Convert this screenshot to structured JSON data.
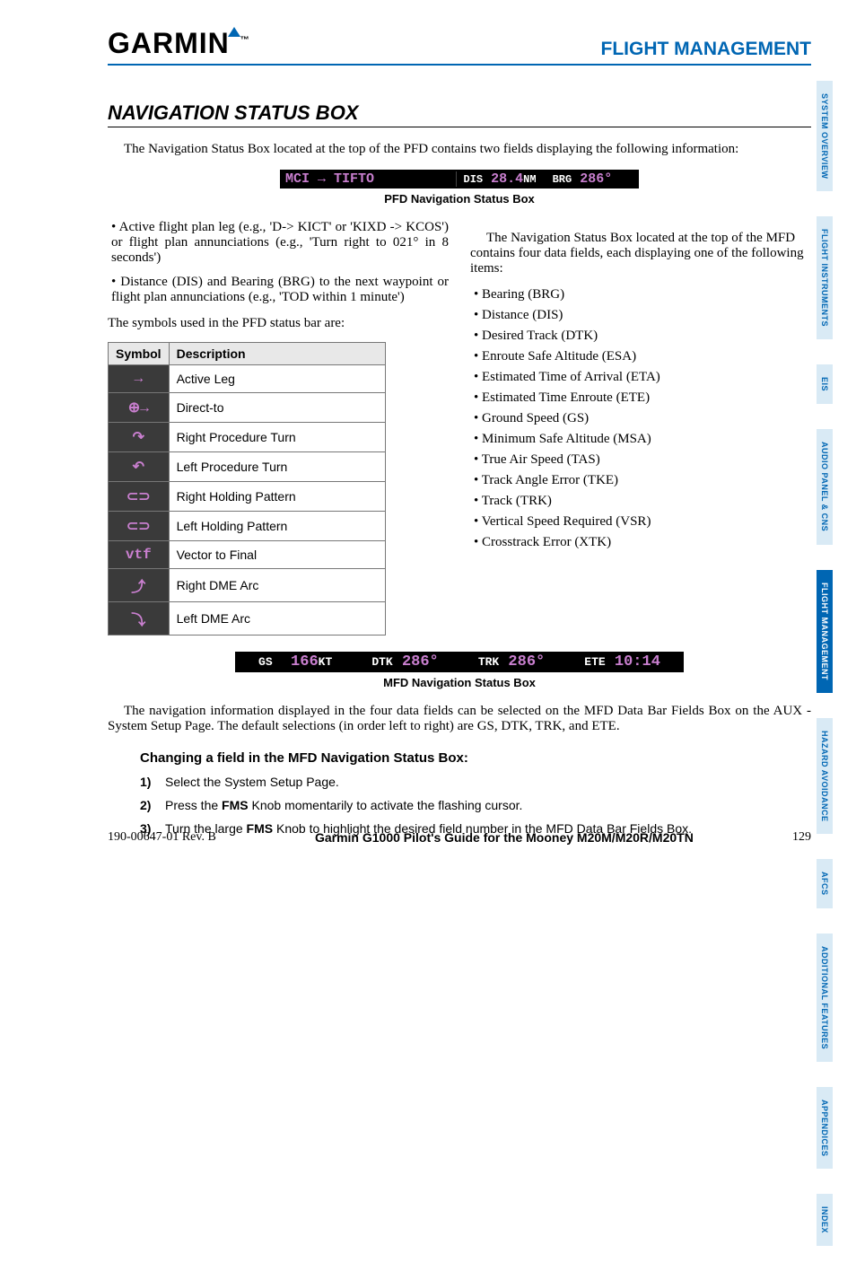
{
  "header": {
    "logo": "GARMIN",
    "section": "FLIGHT MANAGEMENT"
  },
  "title": "NAVIGATION STATUS BOX",
  "intro": "The Navigation Status Box located at the top of the PFD contains two fields displaying the following information:",
  "pfd_bar": {
    "left_from": "MCI",
    "left_to": "TIFTO",
    "dis_label": "DIS",
    "dis_val": "28.4",
    "dis_unit": "NM",
    "brg_label": "BRG",
    "brg_val": "286°"
  },
  "pfd_caption": "PFD Navigation Status Box",
  "left_bullets": [
    "Active flight plan leg (e.g., 'D-> KICT' or 'KIXD -> KCOS') or flight plan annunciations (e.g., 'Turn right to 021° in 8 seconds')",
    "Distance (DIS) and Bearing (BRG) to the next waypoint or flight plan annunciations (e.g., 'TOD within 1 minute')"
  ],
  "left_para": "The symbols used in the PFD status bar are:",
  "table": {
    "col1": "Symbol",
    "col2": "Description",
    "rows": [
      {
        "sym": "→",
        "desc": "Active Leg"
      },
      {
        "sym": "⊕→",
        "desc": "Direct-to"
      },
      {
        "sym": "↷",
        "desc": "Right Procedure Turn"
      },
      {
        "sym": "↶",
        "desc": "Left Procedure Turn"
      },
      {
        "sym": "⊂⊃",
        "desc": "Right Holding Pattern"
      },
      {
        "sym": "⊂⊃",
        "desc": "Left Holding Pattern"
      },
      {
        "sym": "vtf",
        "desc": "Vector to Final"
      },
      {
        "sym": "⤴",
        "desc": "Right DME Arc"
      },
      {
        "sym": "⤵",
        "desc": "Left DME Arc"
      }
    ]
  },
  "right_intro": "The Navigation Status Box located at the top of the MFD contains four data fields, each displaying one of the following items:",
  "right_bullets": [
    "Bearing (BRG)",
    "Distance (DIS)",
    "Desired Track (DTK)",
    "Enroute Safe Altitude (ESA)",
    "Estimated Time of Arrival (ETA)",
    "Estimated Time Enroute (ETE)",
    "Ground Speed (GS)",
    "Minimum Safe Altitude (MSA)",
    "True Air Speed (TAS)",
    "Track Angle Error (TKE)",
    "Track (TRK)",
    "Vertical Speed Required (VSR)",
    "Crosstrack Error (XTK)"
  ],
  "mfd_bar": {
    "gs_label": "GS",
    "gs_val": "166",
    "gs_unit": "KT",
    "dtk_label": "DTK",
    "dtk_val": "286°",
    "trk_label": "TRK",
    "trk_val": "286°",
    "ete_label": "ETE",
    "ete_val": "10:14"
  },
  "mfd_caption": "MFD Navigation Status Box",
  "body_para": "The navigation information displayed in the four data fields can be selected on the MFD Data Bar Fields Box on the AUX - System Setup Page.  The default selections (in order left to right) are GS, DTK, TRK, and ETE.",
  "procedure_title": "Changing a field in the MFD Navigation Status Box:",
  "steps": [
    {
      "n": "1)",
      "t": "Select the System Setup Page."
    },
    {
      "n": "2)",
      "t_pre": "Press the ",
      "t_bold": "FMS",
      "t_post": " Knob momentarily to activate the flashing cursor."
    },
    {
      "n": "3)",
      "t_pre": "Turn the large ",
      "t_bold": "FMS",
      "t_post": " Knob to highlight the desired field number in the MFD Data Bar Fields Box."
    }
  ],
  "footer": {
    "left": "190-00647-01  Rev. B",
    "mid": "Garmin G1000 Pilot's Guide for the Mooney M20M/M20R/M20TN",
    "right": "129"
  },
  "tabs": [
    "SYSTEM OVERVIEW",
    "FLIGHT INSTRUMENTS",
    "EIS",
    "AUDIO PANEL & CNS",
    "FLIGHT MANAGEMENT",
    "HAZARD AVOIDANCE",
    "AFCS",
    "ADDITIONAL FEATURES",
    "APPENDICES",
    "INDEX"
  ],
  "active_tab_index": 4
}
